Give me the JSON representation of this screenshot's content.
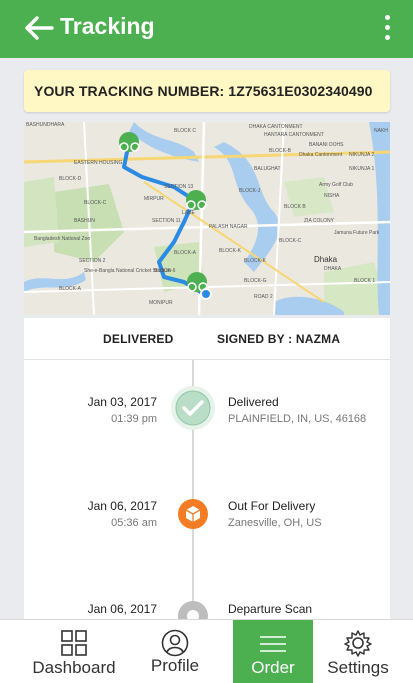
{
  "header": {
    "title": "Tracking",
    "back_icon": "back-arrow-icon",
    "menu_icon": "more-vert-icon",
    "color": "#4caf50"
  },
  "tracking": {
    "label": "YOUR TRACKING NUMBER: 1Z75631E0302340490"
  },
  "map": {
    "labels": [
      "BASHUNDHARA",
      "EASTERN HOUSING",
      "BLOCK-D",
      "BLOCK-C",
      "SECTION 13",
      "SECTION 11",
      "SECTION 2",
      "BLOCK-A",
      "PALASH NAGAR",
      "DHAKA CANTONMENT",
      "NIKUNJA 2",
      "BALUGHAT",
      "NIKUNJA 1",
      "Army Golf Club",
      "ZIA COLONY",
      "BANANI DOHS",
      "BLOCK C",
      "BLOCK-J",
      "BLOCK-K",
      "NISHA",
      "Jamuna Future Park",
      "MIRPUR",
      "LAKE",
      "BLOCK-A",
      "MONIPUR",
      "Dhaka",
      "BLOCK-C",
      "BLOCK-G",
      "ROAD 2",
      "NAKH",
      "BLOCK-K",
      "BLOCK B",
      "BASHUN",
      "BLOCK 1",
      "BLOCK-6",
      "BLOCK-B",
      "HANTARA CANTONMENT",
      "Dhaka Cantonment",
      "Bangladesh National Zoo",
      "She-e-Bangla National Cricket Stadium",
      "DHAKA"
    ]
  },
  "status_card": {
    "delivered": "DELIVERED",
    "signed_by": "SIGNED BY : NAZMA"
  },
  "events": [
    {
      "date": "Jan 03, 2017",
      "time": "01:39 pm",
      "status": "Delivered",
      "location": "PLAINFIELD, IN, US, 46168",
      "icon": "check-circle-icon",
      "color": "#4caf50"
    },
    {
      "date": "Jan 06, 2017",
      "time": "05:36 am",
      "status": "Out For Delivery",
      "location": "Zanesville, OH, US",
      "icon": "package-icon",
      "color": "#f57c22"
    },
    {
      "date": "Jan 06, 2017",
      "time": "",
      "status": "Departure Scan",
      "location": "",
      "icon": "scan-dot-icon",
      "color": "#bdbdbd"
    }
  ],
  "nav": [
    {
      "label": "Dashboard",
      "icon": "grid-icon",
      "active": false
    },
    {
      "label": "Profile",
      "icon": "person-icon",
      "active": false
    },
    {
      "label": "Order",
      "icon": "order-lines-icon",
      "active": true
    },
    {
      "label": "Settings",
      "icon": "gear-icon",
      "active": false
    }
  ]
}
